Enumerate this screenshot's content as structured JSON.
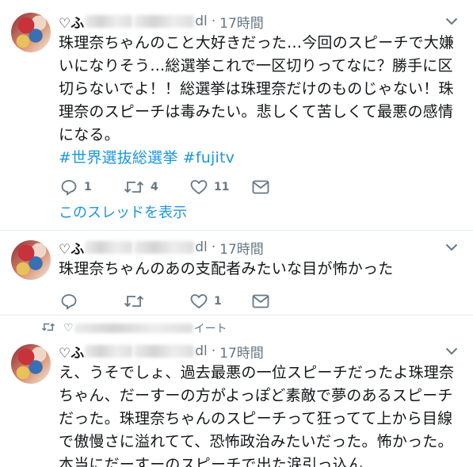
{
  "tweets": [
    {
      "name_prefix": "♡ふ",
      "handle_tail": "dl",
      "separator": "·",
      "time": "17時間",
      "text": "珠理奈ちゃんのこと大好きだった…今回のスピーチで大嫌いになりそう…総選挙これで一区切りってなに？勝手に区切らないでよ！！総選挙は珠理奈だけのものじゃない！珠理奈のスピーチは毒みたい。悲しくて苦しくて最悪の感情になる。",
      "hashtags": "#世界選抜総選挙 #fujitv",
      "reply_count": "1",
      "retweet_count": "4",
      "like_count": "11",
      "thread_link": "このスレッドを表示"
    },
    {
      "name_prefix": "♡ふ",
      "handle_tail": "dl",
      "separator": "·",
      "time": "17時間",
      "text": "珠理奈ちゃんのあの支配者みたいな目が怖かった",
      "like_count": "1"
    },
    {
      "retweet_context_prefix": "♡",
      "retweet_context_suffix": "イート",
      "name_prefix": "♡ふ",
      "handle_tail": "dl",
      "separator": "·",
      "time": "17時間",
      "text": "え、うそでしょ、過去最悪の一位スピーチだったよ珠理奈ちゃん、だーすーの方がよっぽど素敵で夢のあるスピーチだった。珠理奈ちゃんのスピーチって狂ってて上から目線で傲慢さに溢れてて、恐怖政治みたいだった。怖かった。本当にだーすーのスピーチで出た涙引っ込ん"
    }
  ],
  "icons": [
    "chevron-down-icon",
    "reply-icon",
    "retweet-icon",
    "like-icon",
    "direct-message-icon"
  ],
  "colors": {
    "link": "#1b95e0",
    "muted": "#657786",
    "text": "#14171a",
    "divider": "#e6ecf0"
  }
}
